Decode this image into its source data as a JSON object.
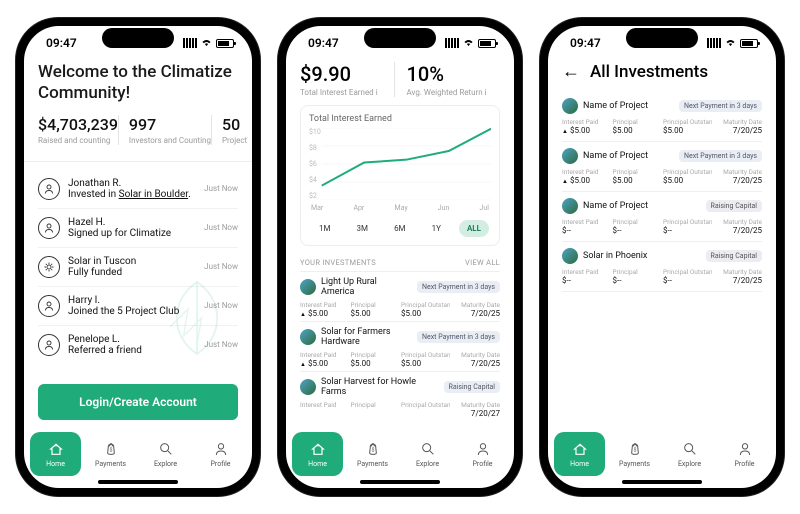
{
  "status": {
    "time": "09:47"
  },
  "tabs": {
    "home": "Home",
    "payments": "Payments",
    "explore": "Explore",
    "profile": "Profile"
  },
  "s1": {
    "welcome": "Welcome to the Climatize Community!",
    "stats": [
      {
        "v": "$4,703,239",
        "l": "Raised and counting"
      },
      {
        "v": "997",
        "l": "Investors and Counting"
      },
      {
        "v": "50",
        "l": "Project"
      }
    ],
    "feed": [
      {
        "name": "Jonathan R.",
        "sub_pre": "Invested in ",
        "sub_link": "Solar in Boulder",
        "sub_post": ".",
        "time": "Just Now",
        "icon": "user"
      },
      {
        "name": "Hazel H.",
        "sub_pre": "Signed up for Climatize",
        "sub_link": "",
        "sub_post": "",
        "time": "Just Now",
        "icon": "user"
      },
      {
        "name": "Solar in Tuscon",
        "sub_pre": "Fully funded",
        "sub_link": "",
        "sub_post": "",
        "time": "Just Now",
        "icon": "gear"
      },
      {
        "name": "Harry I.",
        "sub_pre": "Joined the 5 Project Club",
        "sub_link": "",
        "sub_post": "",
        "time": "Just Now",
        "icon": "user"
      },
      {
        "name": "Penelope L.",
        "sub_pre": "Referred a friend",
        "sub_link": "",
        "sub_post": "",
        "time": "Just Now",
        "icon": "user"
      }
    ],
    "cta": "Login/Create Account"
  },
  "s2": {
    "kpis": [
      {
        "v": "$9.90",
        "l": "Total Interest Earned"
      },
      {
        "v": "10%",
        "l": "Avg. Weighted Return"
      }
    ],
    "chart_card_title": "Total Interest Earned",
    "ranges": [
      "1M",
      "3M",
      "6M",
      "1Y",
      "ALL"
    ],
    "range_active": "ALL",
    "section": "YOUR INVESTMENTS",
    "viewall": "VIEW ALL",
    "metric_labels": {
      "ip": "Interest Paid",
      "p": "Principal",
      "po": "Principal Outstanding",
      "md": "Maturity Date"
    },
    "invs": [
      {
        "name": "Light Up Rural America",
        "chip": "Next Payment in 3 days",
        "ip": "$5.00",
        "p": "$5.00",
        "po": "$5.00",
        "md": "7/20/25"
      },
      {
        "name": "Solar for Farmers Hardware",
        "chip": "Next Payment in 3 days",
        "ip": "$5.00",
        "p": "$5.00",
        "po": "$5.00",
        "md": "7/20/25"
      },
      {
        "name": "Solar Harvest for Howle Farms",
        "chip": "Raising Capital",
        "ip": "",
        "p": "",
        "po": "",
        "md": "7/20/27"
      }
    ]
  },
  "s3": {
    "title": "All Investments",
    "invs": [
      {
        "name": "Name of Project",
        "chip": "Next Payment in 3 days",
        "chipalt": false,
        "ip": "$5.00",
        "p": "$5.00",
        "po": "$5.00",
        "md": "7/20/25"
      },
      {
        "name": "Name of Project",
        "chip": "Next Payment in 3 days",
        "chipalt": false,
        "ip": "$5.00",
        "p": "$5.00",
        "po": "$5.00",
        "md": "7/20/25"
      },
      {
        "name": "Name of Project",
        "chip": "Raising Capital",
        "chipalt": true,
        "ip": "$--",
        "p": "$--",
        "po": "$--",
        "md": "7/20/25"
      },
      {
        "name": "Solar in Phoenix",
        "chip": "Raising Capital",
        "chipalt": true,
        "ip": "$--",
        "p": "$--",
        "po": "$--",
        "md": "7/20/25"
      }
    ]
  },
  "chart_data": {
    "type": "line",
    "title": "Total Interest Earned",
    "x": [
      "Mar",
      "Apr",
      "May",
      "Jun",
      "Jul"
    ],
    "y": [
      2.0,
      5.2,
      5.6,
      6.8,
      9.9
    ],
    "ylabel": "$",
    "yticks": [
      2,
      4,
      6,
      8,
      10
    ],
    "ylim": [
      0,
      10
    ]
  }
}
